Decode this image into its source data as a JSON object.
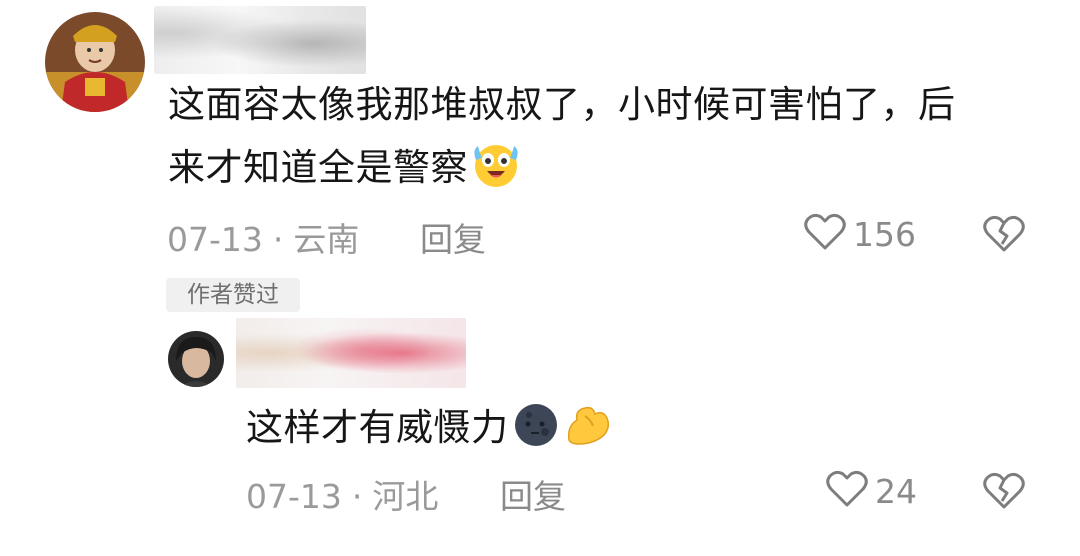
{
  "comment": {
    "avatar_icon": "deity-statue-avatar",
    "text_line1": "这面容太像我那堆叔叔了，小时候可害怕了，后",
    "text_line2": "来才知道全是警察",
    "emoji": "tearful-smile-emoji",
    "date": "07-13",
    "separator": "·",
    "location": "云南",
    "reply_label": "回复",
    "like_count": "156",
    "author_badge": "作者赞过"
  },
  "reply": {
    "avatar_icon": "girl-portrait-avatar",
    "text": "这样才有威慑力",
    "emojis": [
      "dark-moon-face-emoji",
      "flexed-arm-emoji"
    ],
    "date": "07-13",
    "separator": "·",
    "location": "河北",
    "reply_label": "回复",
    "like_count": "24"
  },
  "colors": {
    "meta_gray": "#9a9a9a",
    "text": "#161616",
    "badge_bg": "#f0f0f0"
  }
}
